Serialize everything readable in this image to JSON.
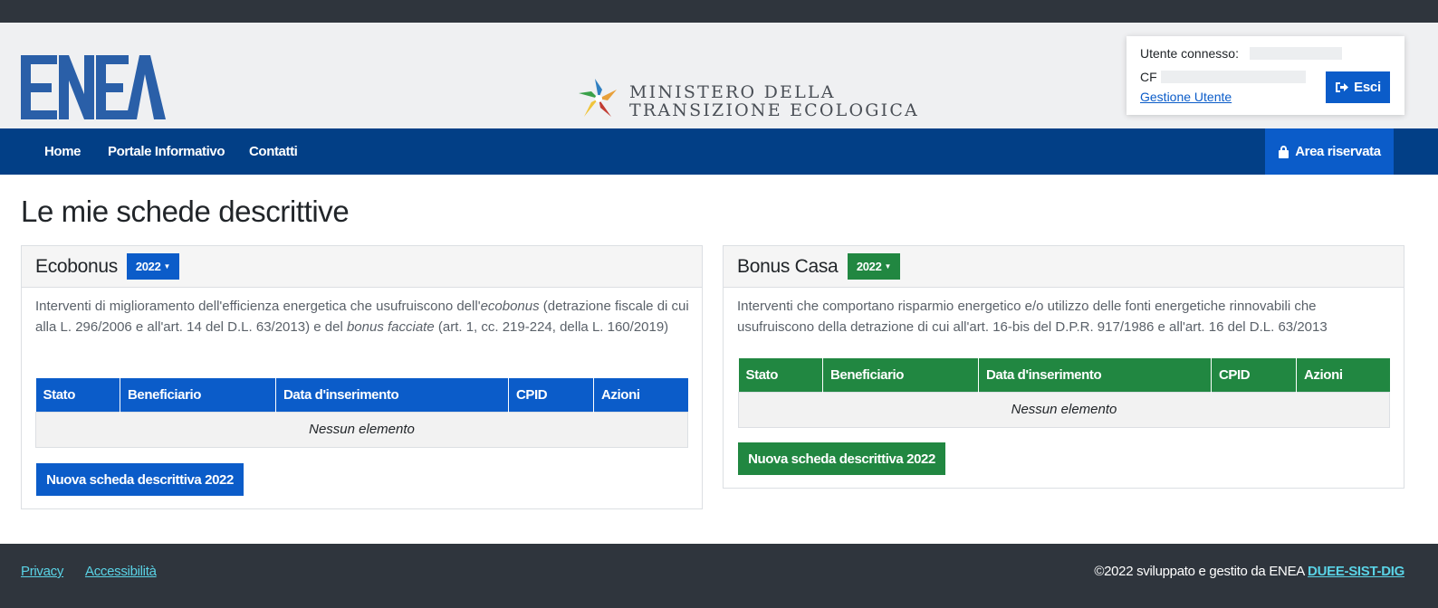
{
  "header": {
    "logo_text": "ENEA",
    "ministry_line1": "MINISTERO DELLA",
    "ministry_line2": "TRANSIZIONE ECOLOGICA"
  },
  "user_panel": {
    "user_label": "Utente connesso:",
    "cf_label": "CF",
    "manage_link": "Gestione Utente",
    "logout_label": "Esci"
  },
  "nav": {
    "items": [
      "Home",
      "Portale Informativo",
      "Contatti"
    ],
    "reserved_area": "Area riservata"
  },
  "page_title": "Le mie schede descrittive",
  "ecobonus": {
    "title": "Ecobonus",
    "year": "2022",
    "desc_1": "Interventi di miglioramento dell'efficienza energetica che usufruiscono dell'",
    "desc_em1": "ecobonus",
    "desc_2": " (detrazione fiscale di cui alla L. 296/2006 e all'art. 14 del D.L. 63/2013) e del ",
    "desc_em2": "bonus facciate",
    "desc_3": " (art. 1, cc. 219-224, della L. 160/2019)",
    "columns": [
      "Stato",
      "Beneficiario",
      "Data d'inserimento",
      "CPID",
      "Azioni"
    ],
    "empty": "Nessun elemento",
    "new_button": "Nuova scheda descrittiva 2022",
    "accent": "#0b5cc9"
  },
  "bonus_casa": {
    "title": "Bonus Casa",
    "year": "2022",
    "desc": "Interventi che comportano risparmio energetico e/o utilizzo delle fonti energetiche rinnovabili che usufruiscono della detrazione di cui all'art. 16-bis del D.P.R. 917/1986 e all'art. 16 del D.L. 63/2013",
    "columns": [
      "Stato",
      "Beneficiario",
      "Data d'inserimento",
      "CPID",
      "Azioni"
    ],
    "empty": "Nessun elemento",
    "new_button": "Nuova scheda descrittiva 2022",
    "accent": "#218741"
  },
  "footer": {
    "privacy": "Privacy",
    "accessibility": "Accessibilità",
    "copyright": "©2022 sviluppato e gestito da ENEA",
    "dept_link": "DUEE-SIST-DIG"
  }
}
